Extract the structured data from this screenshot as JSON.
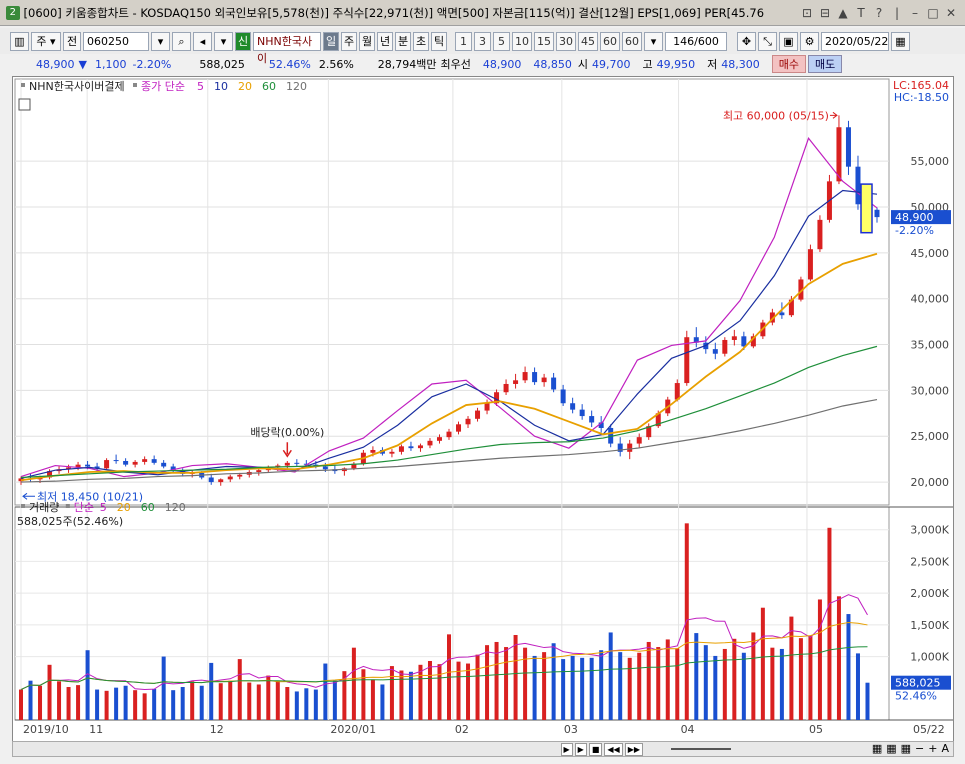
{
  "window": {
    "badge": "2",
    "title": "[0600] 키움종합차트 - KOSDAQ150 외국인보유[5,578(천)] 주식수[22,971(천)] 액면[500] 자본금[115(억)] 결산[12월] EPS[1,069] PER[45.76",
    "controls": [
      "⊡",
      "⊟",
      "▲",
      "T",
      "?",
      "|",
      "–",
      "□",
      "✕"
    ]
  },
  "toolbar": {
    "type_select": "주",
    "prev_label": "전",
    "code": "060250",
    "new_badge": "신",
    "stock_name": "NHN한국사이",
    "periods": [
      "일",
      "주",
      "월",
      "년",
      "분",
      "초",
      "틱"
    ],
    "active_period": "일",
    "minutes": [
      "1",
      "3",
      "5",
      "10",
      "15",
      "30",
      "45",
      "60",
      "60"
    ],
    "count": "146/600",
    "date": "2020/05/22"
  },
  "quote": {
    "price": "48,900",
    "change": "1,100",
    "change_pct": "-2.20%",
    "volume": "588,025",
    "vol_ratio": "52.46%",
    "turnover": "2.56%",
    "amount": "28,794백만",
    "best_label": "최우선",
    "best_ask": "48,900",
    "best_bid": "48,850",
    "open_label": "시",
    "open": "49,700",
    "high_label": "고",
    "high": "49,950",
    "low_label": "저",
    "low": "48,300",
    "buy_label": "매수",
    "sell_label": "매도"
  },
  "price_legend": {
    "name": "NHN한국사이버결제",
    "series_label": "종가 단순",
    "periods": [
      "5",
      "10",
      "20",
      "60",
      "120"
    ],
    "lc": "LC:165.04",
    "hc": "HC:-18.50"
  },
  "volume_legend": {
    "name": "거래량",
    "series_label": "단순",
    "periods": [
      "5",
      "20",
      "60",
      "120"
    ],
    "current": "588,025주(52.46%)"
  },
  "annotations": {
    "high": "최고 60,000 (05/15)",
    "low": "최저 18,450 (10/21)",
    "dividend": "배당락(0.00%)",
    "last_price": "48,900",
    "last_pct": "-2.20%",
    "last_vol": "588,025",
    "last_vol_pct": "52.46%"
  },
  "price_axis": [
    "55,000",
    "50,000",
    "45,000",
    "40,000",
    "35,000",
    "30,000",
    "25,000",
    "20,000"
  ],
  "volume_axis": [
    "3,000K",
    "2,500K",
    "2,000K",
    "1,500K",
    "1,000K"
  ],
  "date_axis": [
    "2019/10",
    "11",
    "12",
    "2020/01",
    "02",
    "03",
    "04",
    "05"
  ],
  "date_axis_end": "05/22",
  "colors": {
    "up": "#d92020",
    "down": "#1a4fd0",
    "ma5": "#c020c0",
    "ma10": "#1a2fa0",
    "ma20": "#e8a000",
    "ma60": "#1f8f3a",
    "ma120": "#707070"
  },
  "chart_data": {
    "type": "candlestick",
    "x_start": "2019-10-15",
    "x_end": "2020-05-22",
    "ylim_price": [
      17500,
      62000
    ],
    "ylim_volume": [
      0,
      3200000
    ],
    "candles": [
      [
        20100,
        20600,
        19700,
        20400
      ],
      [
        20400,
        20900,
        20000,
        20300
      ],
      [
        20300,
        20700,
        19900,
        20500
      ],
      [
        20500,
        21400,
        20300,
        21200
      ],
      [
        21200,
        21700,
        20900,
        21400
      ],
      [
        21400,
        21900,
        21000,
        21600
      ],
      [
        21600,
        22200,
        21300,
        21900
      ],
      [
        21900,
        22300,
        21400,
        21700
      ],
      [
        21700,
        22100,
        21200,
        21500
      ],
      [
        21500,
        22600,
        21400,
        22400
      ],
      [
        22400,
        23000,
        22000,
        22300
      ],
      [
        22300,
        22600,
        21700,
        21900
      ],
      [
        21900,
        22400,
        21600,
        22200
      ],
      [
        22200,
        22800,
        21900,
        22500
      ],
      [
        22500,
        22900,
        21900,
        22100
      ],
      [
        22100,
        22400,
        21500,
        21700
      ],
      [
        21700,
        22000,
        21000,
        21200
      ],
      [
        21200,
        21500,
        20600,
        20900
      ],
      [
        20900,
        21300,
        20500,
        21000
      ],
      [
        21000,
        21200,
        20300,
        20500
      ],
      [
        20500,
        20900,
        19700,
        20000
      ],
      [
        20000,
        20400,
        19600,
        20300
      ],
      [
        20300,
        20800,
        20000,
        20600
      ],
      [
        20600,
        21000,
        20300,
        20800
      ],
      [
        20800,
        21300,
        20500,
        21100
      ],
      [
        21100,
        21500,
        20700,
        21300
      ],
      [
        21300,
        21800,
        21000,
        21600
      ],
      [
        21600,
        22000,
        21200,
        21800
      ],
      [
        21800,
        22300,
        21500,
        22100
      ],
      [
        22100,
        22500,
        21700,
        22000
      ],
      [
        22000,
        22400,
        21600,
        21900
      ],
      [
        21900,
        22300,
        21500,
        21700
      ],
      [
        21700,
        22100,
        21100,
        21400
      ],
      [
        21400,
        21800,
        20900,
        21200
      ],
      [
        21200,
        21600,
        20700,
        21500
      ],
      [
        21500,
        22200,
        21300,
        22000
      ],
      [
        22000,
        23500,
        21800,
        23200
      ],
      [
        23200,
        23900,
        22800,
        23500
      ],
      [
        23500,
        23800,
        22900,
        23100
      ],
      [
        23100,
        23600,
        22700,
        23300
      ],
      [
        23300,
        24100,
        23000,
        23900
      ],
      [
        23900,
        24400,
        23400,
        23700
      ],
      [
        23700,
        24200,
        23300,
        24000
      ],
      [
        24000,
        24800,
        23700,
        24500
      ],
      [
        24500,
        25200,
        24200,
        24900
      ],
      [
        24900,
        25800,
        24600,
        25500
      ],
      [
        25500,
        26600,
        25200,
        26300
      ],
      [
        26300,
        27200,
        25900,
        26900
      ],
      [
        26900,
        28100,
        26600,
        27800
      ],
      [
        27800,
        29000,
        27400,
        28600
      ],
      [
        28600,
        30100,
        28300,
        29800
      ],
      [
        29800,
        31200,
        29500,
        30700
      ],
      [
        30700,
        31800,
        30200,
        31100
      ],
      [
        31100,
        32600,
        30800,
        32000
      ],
      [
        32000,
        32500,
        30600,
        30900
      ],
      [
        30900,
        31800,
        30400,
        31400
      ],
      [
        31400,
        31900,
        29800,
        30100
      ],
      [
        30100,
        30600,
        28300,
        28600
      ],
      [
        28600,
        29200,
        27500,
        27900
      ],
      [
        27900,
        28500,
        26800,
        27200
      ],
      [
        27200,
        27800,
        26000,
        26500
      ],
      [
        26500,
        27200,
        25400,
        25900
      ],
      [
        25900,
        26300,
        23800,
        24200
      ],
      [
        24200,
        24900,
        22800,
        23300
      ],
      [
        23300,
        24600,
        22500,
        24200
      ],
      [
        24200,
        25300,
        23700,
        24900
      ],
      [
        24900,
        26400,
        24600,
        26100
      ],
      [
        26100,
        27800,
        25900,
        27500
      ],
      [
        27500,
        29300,
        27200,
        29000
      ],
      [
        29000,
        31200,
        28800,
        30800
      ],
      [
        30800,
        36500,
        30500,
        35800
      ],
      [
        35800,
        36900,
        34700,
        35200
      ],
      [
        35200,
        35900,
        34000,
        34500
      ],
      [
        34500,
        35200,
        33400,
        34000
      ],
      [
        34000,
        35800,
        33700,
        35500
      ],
      [
        35500,
        36600,
        34900,
        35900
      ],
      [
        35900,
        36400,
        34400,
        34800
      ],
      [
        34800,
        36200,
        34600,
        35900
      ],
      [
        35900,
        37700,
        35600,
        37400
      ],
      [
        37400,
        38900,
        37100,
        38500
      ],
      [
        38500,
        39600,
        37800,
        38200
      ],
      [
        38200,
        40300,
        38000,
        39900
      ],
      [
        39900,
        42400,
        39700,
        42100
      ],
      [
        42100,
        45900,
        41900,
        45400
      ],
      [
        45400,
        49100,
        45100,
        48600
      ],
      [
        48600,
        53500,
        48300,
        52800
      ],
      [
        52800,
        60000,
        52500,
        58700
      ],
      [
        58700,
        59400,
        53500,
        54400
      ],
      [
        54400,
        55600,
        49700,
        50300
      ],
      [
        50300,
        51400,
        48400,
        49800
      ],
      [
        49700,
        49950,
        48300,
        48900
      ]
    ],
    "volumes": [
      480000,
      620000,
      540000,
      870000,
      610000,
      520000,
      550000,
      1100000,
      480000,
      460000,
      510000,
      540000,
      470000,
      420000,
      490000,
      1000000,
      470000,
      520000,
      610000,
      540000,
      900000,
      580000,
      620000,
      960000,
      590000,
      560000,
      700000,
      620000,
      520000,
      450000,
      500000,
      480000,
      890000,
      620000,
      770000,
      1140000,
      800000,
      640000,
      560000,
      850000,
      780000,
      760000,
      870000,
      930000,
      880000,
      1350000,
      920000,
      890000,
      1030000,
      1180000,
      1230000,
      1150000,
      1340000,
      1140000,
      1010000,
      1070000,
      1210000,
      960000,
      1010000,
      980000,
      980000,
      1100000,
      1380000,
      1070000,
      980000,
      1060000,
      1230000,
      1150000,
      1270000,
      1130000,
      3100000,
      1370000,
      1180000,
      1010000,
      1120000,
      1280000,
      1060000,
      1380000,
      1770000,
      1140000,
      1120000,
      1630000,
      1290000,
      1330000,
      1900000,
      3030000,
      1950000,
      1670000,
      1050000,
      588025
    ],
    "ma": {
      "5": [
        20600,
        21800,
        21500,
        20600,
        21000,
        21800,
        22000,
        21600,
        21100,
        23400,
        24800,
        27800,
        30700,
        31100,
        28100,
        25000,
        23700,
        26600,
        33300,
        34900,
        35400,
        39800,
        46700,
        57500,
        52800,
        49900
      ],
      "10": [
        20400,
        21300,
        21600,
        21100,
        20800,
        21300,
        21700,
        21600,
        21300,
        22600,
        23800,
        26200,
        29300,
        30700,
        28800,
        26200,
        24500,
        25200,
        29600,
        33500,
        34900,
        37600,
        42500,
        49000,
        51800,
        51400
      ],
      "20": [
        20200,
        20700,
        21100,
        21200,
        21000,
        21000,
        21300,
        21500,
        21400,
        21900,
        22600,
        24000,
        26400,
        28400,
        28800,
        28000,
        26600,
        25200,
        25800,
        28500,
        31500,
        34200,
        38000,
        41600,
        43800,
        44900
      ],
      "60": [
        20500,
        20700,
        20900,
        21100,
        21200,
        21300,
        21400,
        21600,
        21700,
        21800,
        22000,
        22400,
        23000,
        23600,
        24100,
        24300,
        24400,
        24800,
        25600,
        26800,
        28000,
        29400,
        30800,
        32500,
        33800,
        34800
      ],
      "120": [
        20000,
        20100,
        20300,
        20400,
        20600,
        20700,
        20900,
        21000,
        21200,
        21300,
        21500,
        21700,
        22000,
        22300,
        22600,
        22800,
        23000,
        23300,
        23700,
        24300,
        24900,
        25600,
        26400,
        27300,
        28300,
        29000
      ]
    }
  }
}
